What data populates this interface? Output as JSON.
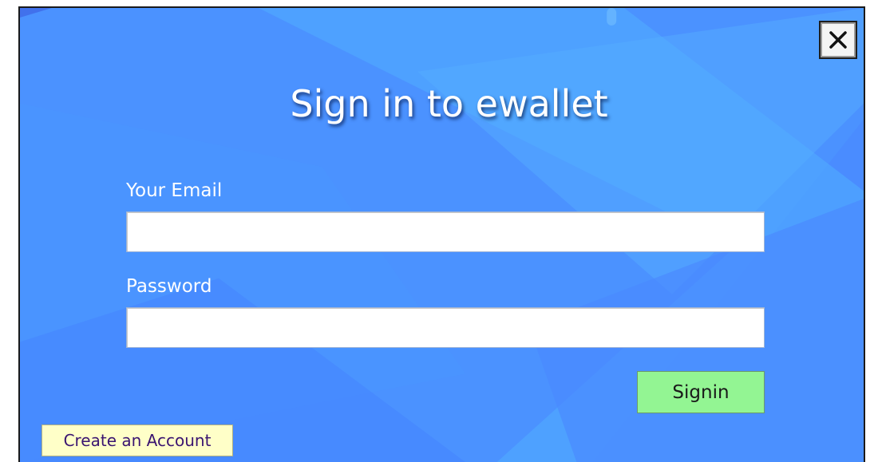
{
  "dialog": {
    "title": "Sign in to ewallet",
    "close_icon": "close-icon"
  },
  "form": {
    "email_label": "Your Email",
    "email_value": "",
    "email_placeholder": "",
    "password_label": "Password",
    "password_value": "",
    "password_placeholder": "",
    "signin_label": "Signin",
    "create_account_label": "Create an Account"
  },
  "colors": {
    "background": "#4a8cff",
    "signin_button": "#93f593",
    "create_account_button": "#ffffc8",
    "create_account_text": "#3a1470"
  }
}
